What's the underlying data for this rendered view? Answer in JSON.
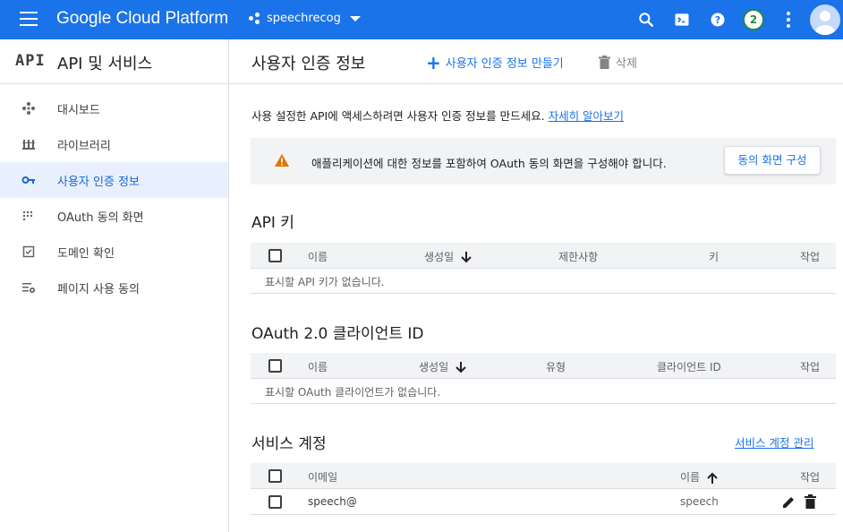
{
  "topbar": {
    "brand": "Google Cloud Platform",
    "project": "speechrecog",
    "notifications": "2",
    "icons": [
      "menu-icon",
      "search-icon",
      "cloud-shell-icon",
      "help-icon",
      "more-vert-icon",
      "account-avatar"
    ]
  },
  "sidebar": {
    "logo": "API",
    "title": "API 및 서비스",
    "items": [
      {
        "label": "대시보드",
        "icon": "dashboard-icon"
      },
      {
        "label": "라이브러리",
        "icon": "library-icon"
      },
      {
        "label": "사용자 인증 정보",
        "icon": "key-icon",
        "active": true
      },
      {
        "label": "OAuth 동의 화면",
        "icon": "oauth-consent-icon"
      },
      {
        "label": "도메인 확인",
        "icon": "domain-check-icon"
      },
      {
        "label": "페이지 사용 동의",
        "icon": "page-usage-icon"
      }
    ]
  },
  "header": {
    "title": "사용자 인증 정보",
    "create": "사용자 인증 정보 만들기",
    "delete": "삭제"
  },
  "intro": {
    "text": "사용 설정한 API에 액세스하려면 사용자 인증 정보를 만드세요.",
    "link": "자세히 알아보기"
  },
  "warning": {
    "message": "애플리케이션에 대한 정보를 포함하여 OAuth 동의 화면을 구성해야 합니다.",
    "button": "동의 화면 구성"
  },
  "api_keys": {
    "title": "API 키",
    "columns": [
      "이름",
      "생성일",
      "제한사항",
      "키",
      "작업"
    ],
    "empty": "표시할 API 키가 없습니다."
  },
  "oauth": {
    "title": "OAuth 2.0 클라이언트 ID",
    "columns": [
      "이름",
      "생성일",
      "유형",
      "클라이언트 ID",
      "작업"
    ],
    "empty": "표시할 OAuth 클라이언트가 없습니다."
  },
  "service_accounts": {
    "title": "서비스 계정",
    "manage_link": "서비스 계정 관리",
    "columns": [
      "이메일",
      "이름",
      "작업"
    ],
    "rows": [
      {
        "email": "speech@",
        "name": "speech"
      }
    ]
  },
  "colors": {
    "primary": "#1a73e8",
    "active_bg": "#e8f0fe",
    "warning": "#e37400",
    "badge": "#1e8e3e"
  }
}
